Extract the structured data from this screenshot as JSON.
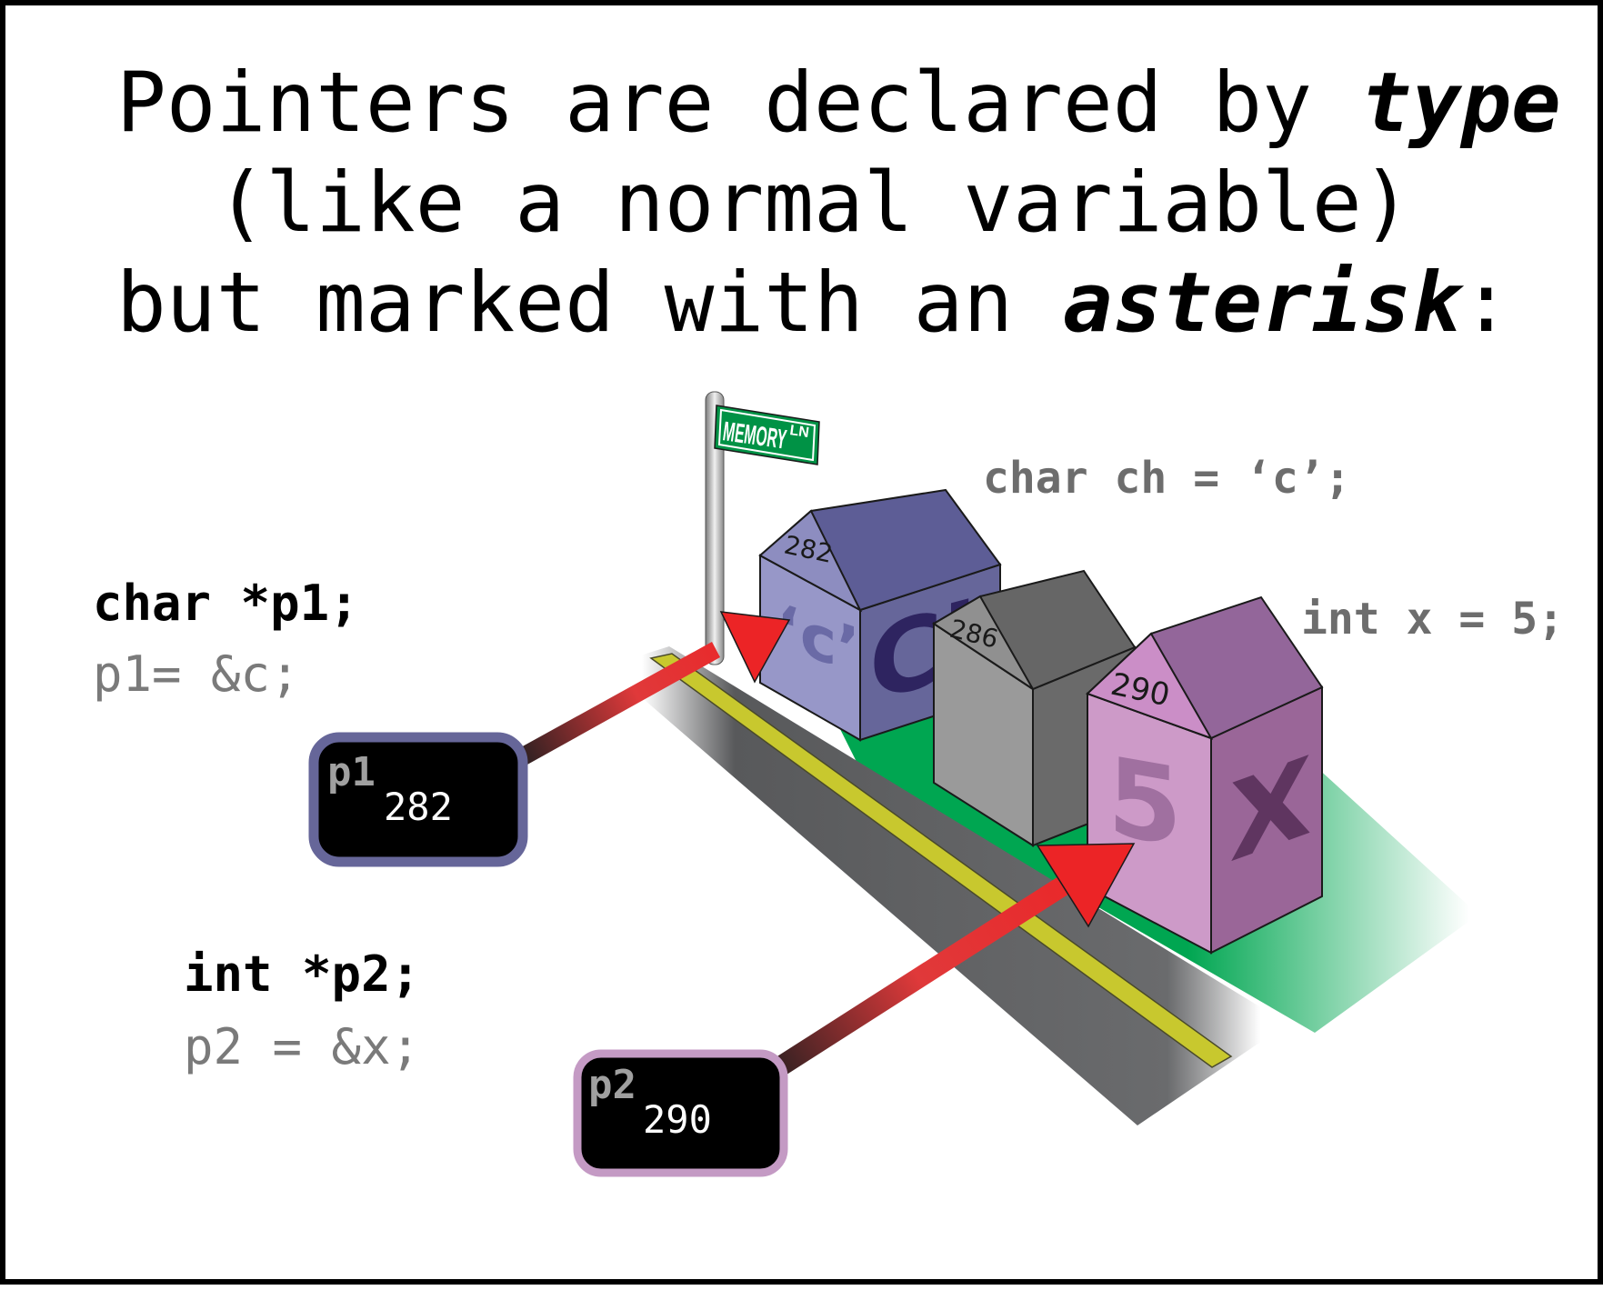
{
  "heading": {
    "line1_text": "Pointers are declared by ",
    "line1_emph": "type",
    "line2_text": "  (like a normal variable)",
    "line3_text": "but marked with an ",
    "line3_emph": "asterisk",
    "line3_tail": ":"
  },
  "code": {
    "p1_decl": "char *p1;",
    "p1_assign": "p1= &c;",
    "p2_decl": "int *p2;",
    "p2_assign": "p2 = &x;",
    "char_decl": "char ch = ‘c’;",
    "int_decl": "int x = 5;"
  },
  "street_sign": {
    "name": "MEMORY",
    "suffix": "LN"
  },
  "houses": [
    {
      "address": "282",
      "value": "‘c’",
      "name": "Ch",
      "front_color": "#9797c8",
      "side_color": "#66669a",
      "roof_color": "#5d5d96"
    },
    {
      "address": "286",
      "front_color": "#9a9a9a",
      "side_color": "#6a6a6a",
      "roof_color": "#666666"
    },
    {
      "address": "290",
      "value": "5",
      "name": "X",
      "front_color": "#cd9ac8",
      "side_color": "#9a6698",
      "roof_color": "#93669a"
    }
  ],
  "pointers": [
    {
      "name": "p1",
      "value": "282",
      "border_color": "#666699"
    },
    {
      "name": "p2",
      "value": "290",
      "border_color": "#c49ac4"
    }
  ],
  "colors": {
    "arrow": "#ec2426",
    "lawn": "#00a651",
    "road": "#58595b",
    "road_stripe": "#c8c82e",
    "sign": "#009245"
  }
}
